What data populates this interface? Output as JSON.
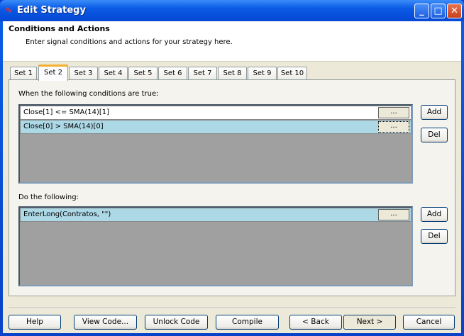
{
  "window": {
    "title": "Edit Strategy"
  },
  "header": {
    "title": "Conditions and Actions",
    "subtitle": "Enter signal conditions and actions for your strategy here."
  },
  "tabs": [
    "Set 1",
    "Set 2",
    "Set 3",
    "Set 4",
    "Set 5",
    "Set 6",
    "Set 7",
    "Set 8",
    "Set 9",
    "Set 10"
  ],
  "active_tab": "Set 2",
  "conditions": {
    "label": "When the following conditions are true:",
    "rows": [
      "Close[1] <= SMA(14)[1]",
      "Close[0] > SMA(14)[0]"
    ],
    "add": "Add",
    "del": "Del"
  },
  "actions": {
    "label": "Do the following:",
    "rows": [
      "EnterLong(Contratos, \"\")"
    ],
    "add": "Add",
    "del": "Del"
  },
  "ellipsis": "...",
  "footer": {
    "help": "Help",
    "view_code": "View Code...",
    "unlock": "Unlock Code",
    "compile": "Compile",
    "back": "< Back",
    "next": "Next >",
    "cancel": "Cancel"
  }
}
